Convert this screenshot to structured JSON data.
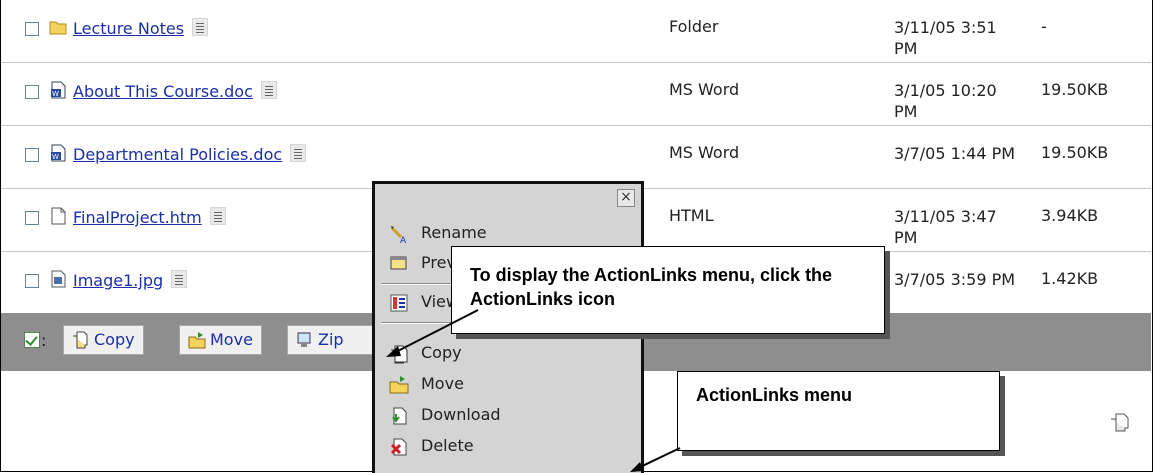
{
  "files": [
    {
      "name": "Lecture Notes",
      "icon": "folder-icon",
      "type": "Folder",
      "date": "3/11/05 3:51 PM",
      "size": "-"
    },
    {
      "name": "About This Course.doc",
      "icon": "word-doc-icon",
      "type": "MS Word",
      "date": "3/1/05 10:20 PM",
      "size": "19.50KB"
    },
    {
      "name": "Departmental Policies.doc",
      "icon": "word-doc-icon",
      "type": "MS Word",
      "date": "3/7/05 1:44 PM",
      "size": "19.50KB"
    },
    {
      "name": "FinalProject.htm",
      "icon": "html-file-icon",
      "type": "HTML",
      "date": "3/11/05 3:47 PM",
      "size": "3.94KB"
    },
    {
      "name": "Image1.jpg",
      "icon": "image-file-icon",
      "type": "",
      "date": "3/7/05 3:59 PM",
      "size": "1.42KB"
    }
  ],
  "toolbar": {
    "colon": ":",
    "copy_label": "Copy",
    "move_label": "Move",
    "zip_label": "Zip"
  },
  "action_menu": {
    "close_symbol": "×",
    "items": [
      "Rename",
      "Preview",
      "View",
      "Copy",
      "Move",
      "Download",
      "Delete"
    ]
  },
  "callouts": {
    "actionlinks_icon": "To display the ActionLinks menu, click the ActionLinks icon",
    "actionlinks_menu": "ActionLinks menu"
  }
}
